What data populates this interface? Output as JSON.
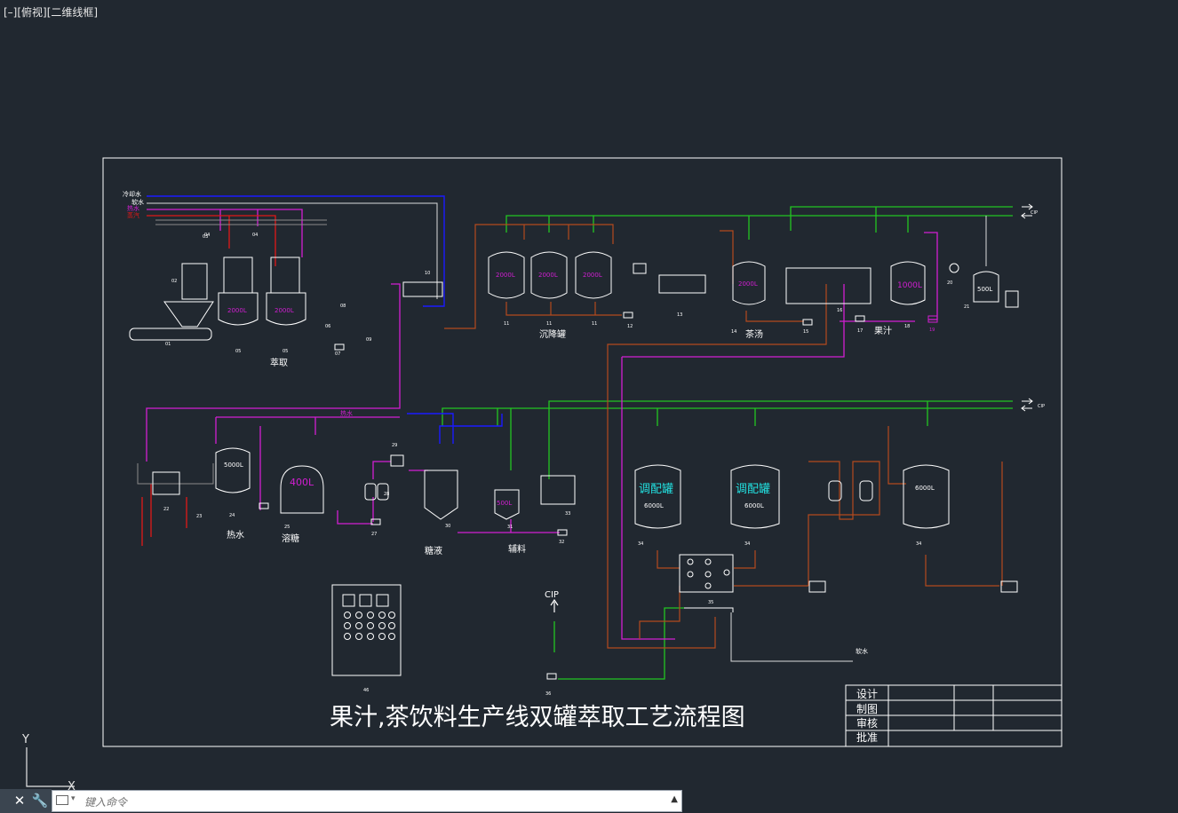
{
  "viewport": {
    "label": "[–][俯视][二维线框]"
  },
  "title": "果汁,茶饮料生产线双罐萃取工艺流程图",
  "utility_labels": {
    "cold_water": "冷却水",
    "soft_water": "软水",
    "hot_water": "热水",
    "steam": "蒸汽",
    "cip": "CIP",
    "cip_small": "CIP",
    "hot_water_small": "热水",
    "soft_water_small": "软水"
  },
  "section_labels": {
    "extraction": "萃取",
    "settling": "沉降罐",
    "tea_soup": "茶汤",
    "juice": "果汁",
    "hot_water": "热水",
    "sugar_dissolve": "溶糖",
    "sugar_liquid": "糖液",
    "auxiliary": "辅料"
  },
  "tank_capacities": {
    "t04a": "2000L",
    "t04b": "2000L",
    "t11a": "2000L",
    "t11b": "2000L",
    "t11c": "2000L",
    "t14": "2000L",
    "t18": "1000L",
    "t21": "500L",
    "t24": "5000L",
    "t25": "400L",
    "t31": "500L",
    "t34a": "6000L",
    "t34b": "6000L",
    "t34c": "6000L"
  },
  "mixing_tank_label": "调配罐",
  "equipment_numbers": [
    "01",
    "02",
    "03",
    "04",
    "05",
    "06",
    "07",
    "08",
    "09",
    "10",
    "11",
    "12",
    "13",
    "14",
    "15",
    "16",
    "17",
    "18",
    "19",
    "20",
    "21",
    "22",
    "23",
    "24",
    "25",
    "27",
    "28",
    "29",
    "30",
    "31",
    "32",
    "33",
    "34",
    "35",
    "36",
    "46"
  ],
  "title_block": {
    "rows": [
      "设计",
      "制图",
      "审核",
      "批准"
    ]
  },
  "ucs": {
    "y": "Y",
    "x": "X"
  },
  "command_line": {
    "placeholder": "键入命令",
    "close": "✕",
    "tools": "🔧"
  },
  "colors": {
    "background": "#212830",
    "frame": "#ffffff",
    "green": "#22c522",
    "blue": "#1a1aff",
    "magenta": "#d21ed2",
    "brown": "#b44a1e",
    "red": "#e01818",
    "cyan": "#22e0e0"
  }
}
